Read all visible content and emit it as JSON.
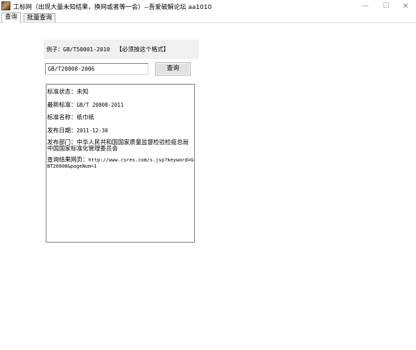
{
  "window": {
    "title": "工标网（出现大量未知结果，换网或者等一会）--吾爱破解论坛 aa1010",
    "min_glyph": "—",
    "max_glyph": "☐",
    "close_glyph": "✕"
  },
  "tabs": [
    {
      "label": "查询",
      "active": true
    },
    {
      "label": "批量查询",
      "active": false
    }
  ],
  "example": {
    "text": "例子：GB/T50001-2010",
    "note": "【必须按这个格式】"
  },
  "search": {
    "value": "GB/T20808-2006",
    "button_label": "查询"
  },
  "result": {
    "status_label": "标准状态：",
    "status_value": "未知",
    "latest_label": "最新标准：",
    "latest_value": "GB/T 20808-2011",
    "name_label": "标准名称：",
    "name_value": "纸巾纸",
    "date_label": "发布日期：",
    "date_value": "2011-12-30",
    "dept_label": "发布部门：",
    "dept_value": "中华人民共和国国家质量监督检验检疫总局  中国国家标准化管理委员会",
    "url_label": "查询结果网页：",
    "url_value": "http://www.csres.com/s.jsp?keyword=GBT20808&pageNum=1"
  }
}
